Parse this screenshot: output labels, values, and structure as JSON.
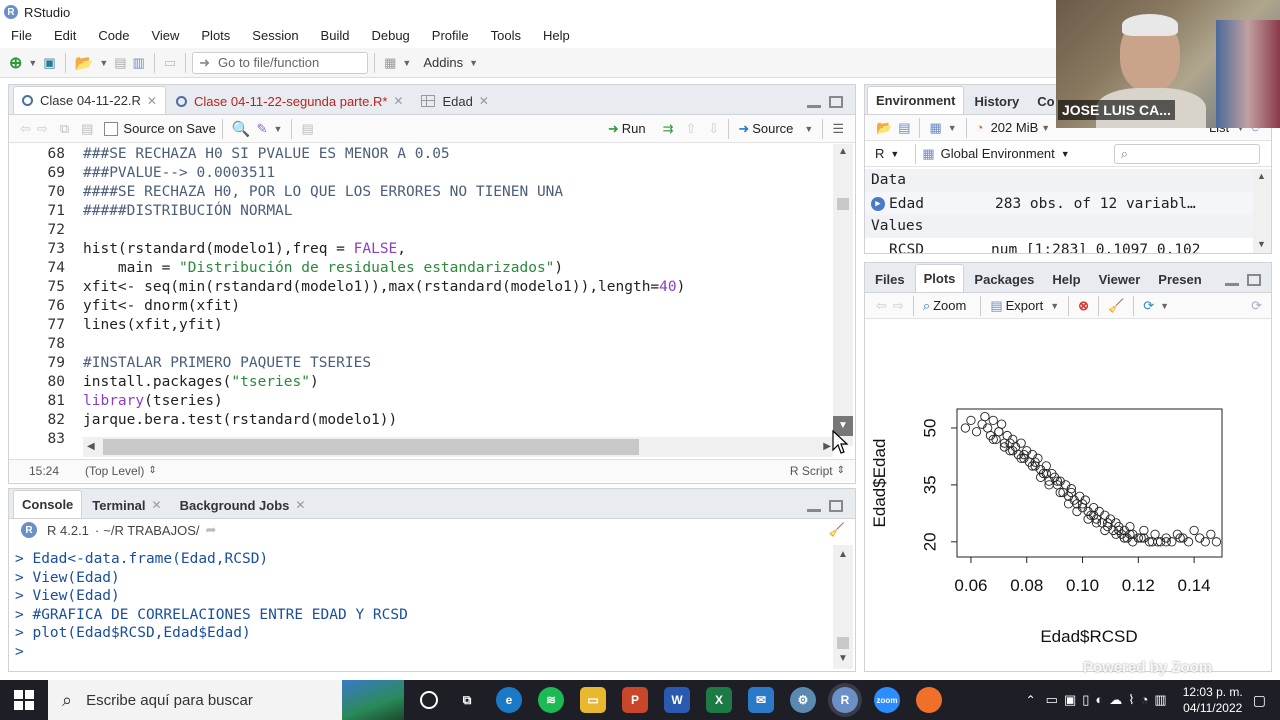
{
  "window": {
    "title": "RStudio"
  },
  "menu": [
    "File",
    "Edit",
    "Code",
    "View",
    "Plots",
    "Session",
    "Build",
    "Debug",
    "Profile",
    "Tools",
    "Help"
  ],
  "toolbar": {
    "goto_placeholder": "Go to file/function",
    "addins": "Addins"
  },
  "editor": {
    "tabs": [
      {
        "label": "Clase 04-11-22.R",
        "modified": false
      },
      {
        "label": "Clase 04-11-22-segunda parte.R*",
        "modified": true
      },
      {
        "label": "Edad",
        "modified": false
      }
    ],
    "source_on_save": "Source on Save",
    "run": "Run",
    "source": "Source",
    "lines": [
      {
        "n": "68",
        "parts": [
          [
            "cm",
            "###SE RECHAZA H0 SI PVALUE ES MENOR A 0.05"
          ]
        ]
      },
      {
        "n": "69",
        "parts": [
          [
            "cm",
            "###PVALUE--> 0.0003511"
          ]
        ]
      },
      {
        "n": "70",
        "parts": [
          [
            "cm",
            "####SE RECHAZA H0, POR LO QUE LOS ERRORES NO TIENEN UNA"
          ]
        ]
      },
      {
        "n": "71",
        "parts": [
          [
            "cm",
            "#####DISTRIBUCIÓN NORMAL"
          ]
        ]
      },
      {
        "n": "72",
        "parts": []
      },
      {
        "n": "73",
        "parts": [
          [
            "tx",
            "hist(rstandard(modelo1),freq = "
          ],
          [
            "kw",
            "FALSE"
          ],
          [
            "tx",
            ","
          ]
        ]
      },
      {
        "n": "74",
        "parts": [
          [
            "tx",
            "    main = "
          ],
          [
            "st",
            "\"Distribución de residuales estandarizados\""
          ],
          [
            "tx",
            ")"
          ]
        ]
      },
      {
        "n": "75",
        "parts": [
          [
            "tx",
            "xfit<- seq(min(rstandard(modelo1)),max(rstandard(modelo1)),length="
          ],
          [
            "nm",
            "40"
          ],
          [
            "tx",
            ")"
          ]
        ]
      },
      {
        "n": "76",
        "parts": [
          [
            "tx",
            "yfit<- dnorm(xfit)"
          ]
        ]
      },
      {
        "n": "77",
        "parts": [
          [
            "tx",
            "lines(xfit,yfit)"
          ]
        ]
      },
      {
        "n": "78",
        "parts": []
      },
      {
        "n": "79",
        "parts": [
          [
            "cm",
            "#INSTALAR PRIMERO PAQUETE TSERIES"
          ]
        ]
      },
      {
        "n": "80",
        "parts": [
          [
            "tx",
            "install.packages("
          ],
          [
            "st",
            "\"tseries\""
          ],
          [
            "tx",
            ")"
          ]
        ]
      },
      {
        "n": "81",
        "parts": [
          [
            "kw",
            "library"
          ],
          [
            "tx",
            "(tseries)"
          ]
        ]
      },
      {
        "n": "82",
        "parts": [
          [
            "tx",
            "jarque.bera.test(rstandard(modelo1))"
          ]
        ]
      },
      {
        "n": "83",
        "parts": []
      }
    ],
    "status": {
      "position": "15:24",
      "scope": "(Top Level)",
      "type": "R Script"
    }
  },
  "console": {
    "tabs": [
      "Console",
      "Terminal",
      "Background Jobs"
    ],
    "version": "R 4.2.1",
    "path": "~/R TRABAJOS/",
    "lines": [
      "> Edad<-data.frame(Edad,RCSD)",
      "> View(Edad)",
      "> View(Edad)",
      "> #GRAFICA DE CORRELACIONES ENTRE EDAD Y RCSD",
      "> plot(Edad$RCSD,Edad$Edad)",
      "> "
    ]
  },
  "environment": {
    "tabs": [
      "Environment",
      "History",
      "Co"
    ],
    "memory": "202 MiB",
    "view_mode": "List",
    "lang": "R",
    "scope": "Global Environment",
    "sections": {
      "data": "Data",
      "values": "Values"
    },
    "rows": [
      {
        "name": "Edad",
        "value": "283 obs. of 12 variabl…"
      },
      {
        "name": "RCSD",
        "value": "num [1:283] 0.1097 0.102"
      }
    ]
  },
  "plots": {
    "tabs": [
      "Files",
      "Plots",
      "Packages",
      "Help",
      "Viewer",
      "Presen"
    ],
    "zoom": "Zoom",
    "export": "Export"
  },
  "chart_data": {
    "type": "scatter",
    "xlabel": "Edad$RCSD",
    "ylabel": "Edad$Edad",
    "xticks": [
      "0.06",
      "0.08",
      "0.10",
      "0.12",
      "0.14"
    ],
    "yticks": [
      "20",
      "35",
      "50"
    ],
    "xlim": [
      0.055,
      0.15
    ],
    "ylim": [
      16,
      55
    ],
    "points_x": [
      0.058,
      0.06,
      0.062,
      0.064,
      0.065,
      0.066,
      0.067,
      0.068,
      0.069,
      0.07,
      0.071,
      0.072,
      0.073,
      0.074,
      0.075,
      0.076,
      0.077,
      0.078,
      0.079,
      0.08,
      0.081,
      0.082,
      0.083,
      0.084,
      0.085,
      0.086,
      0.087,
      0.088,
      0.089,
      0.09,
      0.091,
      0.092,
      0.093,
      0.094,
      0.095,
      0.096,
      0.097,
      0.098,
      0.099,
      0.1,
      0.101,
      0.102,
      0.103,
      0.104,
      0.105,
      0.106,
      0.107,
      0.108,
      0.109,
      0.11,
      0.111,
      0.112,
      0.113,
      0.114,
      0.115,
      0.116,
      0.117,
      0.118,
      0.12,
      0.122,
      0.124,
      0.126,
      0.128,
      0.13,
      0.132,
      0.134,
      0.136,
      0.138,
      0.14,
      0.142,
      0.144,
      0.146,
      0.148,
      0.068,
      0.072,
      0.075,
      0.078,
      0.082,
      0.085,
      0.088,
      0.092,
      0.095,
      0.098,
      0.102,
      0.105,
      0.108,
      0.112,
      0.115,
      0.118,
      0.121,
      0.125,
      0.13,
      0.135,
      0.07,
      0.074,
      0.079,
      0.083,
      0.087,
      0.091,
      0.096,
      0.1,
      0.104,
      0.109,
      0.113,
      0.117,
      0.122,
      0.127
    ],
    "points_y": [
      50,
      52,
      49,
      51,
      53,
      50,
      48,
      52,
      47,
      49,
      51,
      46,
      48,
      44,
      47,
      45,
      43,
      46,
      42,
      44,
      41,
      43,
      40,
      42,
      39,
      38,
      40,
      36,
      38,
      37,
      35,
      36,
      33,
      35,
      32,
      34,
      31,
      30,
      32,
      29,
      31,
      28,
      27,
      29,
      26,
      28,
      25,
      27,
      24,
      26,
      23,
      25,
      24,
      22,
      23,
      21,
      24,
      22,
      21,
      23,
      20,
      22,
      20,
      21,
      20,
      22,
      21,
      20,
      23,
      21,
      20,
      22,
      20,
      47,
      45,
      44,
      42,
      40,
      37,
      35,
      33,
      30,
      28,
      26,
      25,
      23,
      22,
      21,
      20,
      21,
      20,
      20,
      21,
      49,
      46,
      43,
      41,
      38,
      36,
      33,
      30,
      27,
      25,
      23,
      22,
      21,
      20
    ]
  },
  "overlay": {
    "presenter": "JOSE LUIS CA...",
    "powered": "Powered by Zoom"
  },
  "taskbar": {
    "search": "Escribe aquí para buscar",
    "time": "12:03 p. m.",
    "date": "04/11/2022"
  },
  "colors": {
    "accent": "#4a6fa5",
    "comment": "#4b5e7a",
    "string": "#2a8a3a",
    "keyword": "#8a3fc9",
    "console_text": "#1a4fa0"
  }
}
